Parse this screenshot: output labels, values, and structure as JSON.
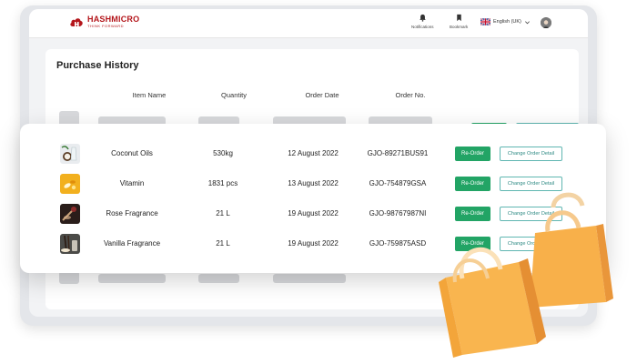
{
  "header": {
    "logo_name": "HASHMICRO",
    "logo_tagline": "THINK FORWARD",
    "notifications_label": "Notifications",
    "bookmark_label": "Bookmark",
    "language_label": "English (UK)"
  },
  "page": {
    "title": "Purchase History"
  },
  "table": {
    "columns": [
      "Item Name",
      "Quantity",
      "Order Date",
      "Order No."
    ],
    "reorder_label": "Re-Order",
    "change_label": "Change Order Detail",
    "rows": [
      {
        "item": "Coconut Oils",
        "quantity": "530kg",
        "date": "12 August 2022",
        "order_no": "GJO-89271BUS91",
        "thumb_icon": "coconut-oil-thumb"
      },
      {
        "item": "Vitamin",
        "quantity": "1831 pcs",
        "date": "13 August 2022",
        "order_no": "GJO-754879GSA",
        "thumb_icon": "vitamin-thumb"
      },
      {
        "item": "Rose Fragrance",
        "quantity": "21 L",
        "date": "19 August 2022",
        "order_no": "GJO-98767987NI",
        "thumb_icon": "rose-fragrance-thumb"
      },
      {
        "item": "Vanilla Fragrance",
        "quantity": "21 L",
        "date": "19 August 2022",
        "order_no": "GJO-759875ASD",
        "thumb_icon": "vanilla-fragrance-thumb"
      }
    ]
  },
  "colors": {
    "brand": "#b4161b",
    "reorder_green": "#22a465",
    "change_teal": "#5fb6b1",
    "bag_orange": "#f8b04a"
  }
}
